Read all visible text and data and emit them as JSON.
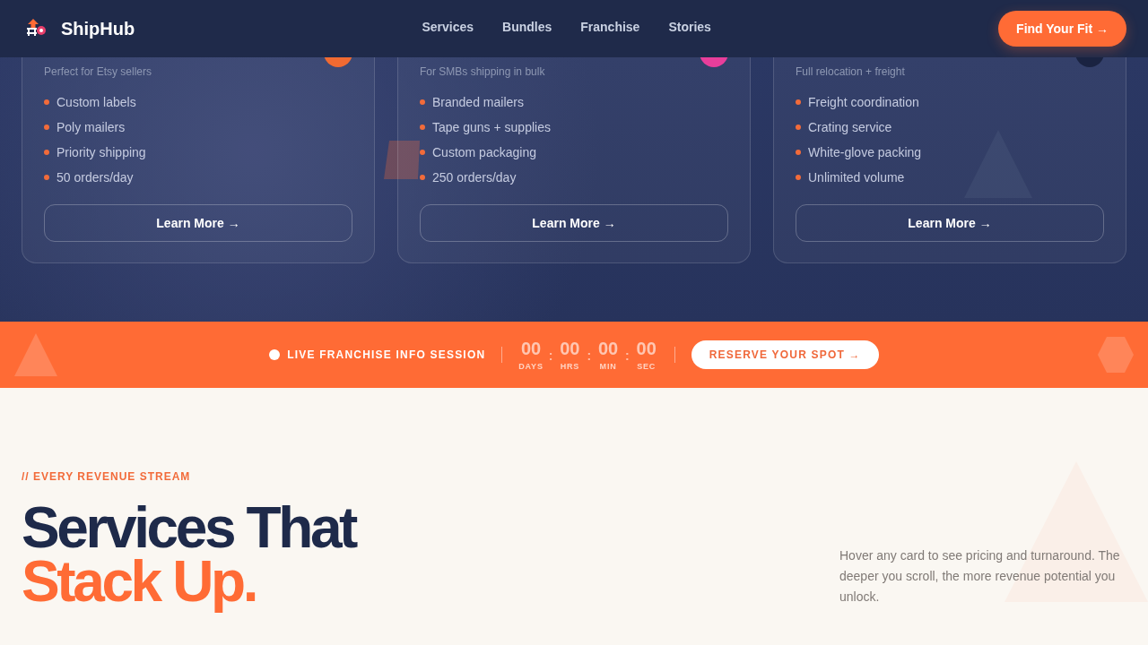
{
  "header": {
    "brand": "ShipHub",
    "nav": [
      "Services",
      "Bundles",
      "Franchise",
      "Stories"
    ],
    "cta": "Find Your Fit →"
  },
  "service_cards": [
    {
      "color": "#f06a32",
      "subtitle": "Perfect for Etsy sellers",
      "features": [
        "Custom labels",
        "Poly mailers",
        "Priority shipping",
        "50 orders/day"
      ],
      "button": "Learn More →"
    },
    {
      "color": "#e83e9b",
      "subtitle": "For SMBs shipping in bulk",
      "features": [
        "Branded mailers",
        "Tape guns + supplies",
        "Custom packaging",
        "250 orders/day"
      ],
      "button": "Learn More →"
    },
    {
      "color": "#1a2341",
      "subtitle": "Full relocation + freight",
      "features": [
        "Freight coordination",
        "Crating service",
        "White-glove packing",
        "Unlimited volume"
      ],
      "button": "Learn More →"
    }
  ],
  "banner": {
    "label": "LIVE FRANCHISE INFO SESSION",
    "countdown": [
      {
        "value": "00",
        "unit": "DAYS"
      },
      {
        "value": "00",
        "unit": "HRS"
      },
      {
        "value": "00",
        "unit": "MIN"
      },
      {
        "value": "00",
        "unit": "SEC"
      }
    ],
    "separators": [
      ":",
      ":",
      ":"
    ],
    "button": "RESERVE YOUR SPOT →"
  },
  "intro": {
    "eyebrow": "// EVERY REVENUE STREAM",
    "title": "Services That",
    "title_accent": "Stack Up.",
    "description": "Hover any card to see pricing and turnaround. The deeper you scroll, the more revenue potential you unlock."
  }
}
